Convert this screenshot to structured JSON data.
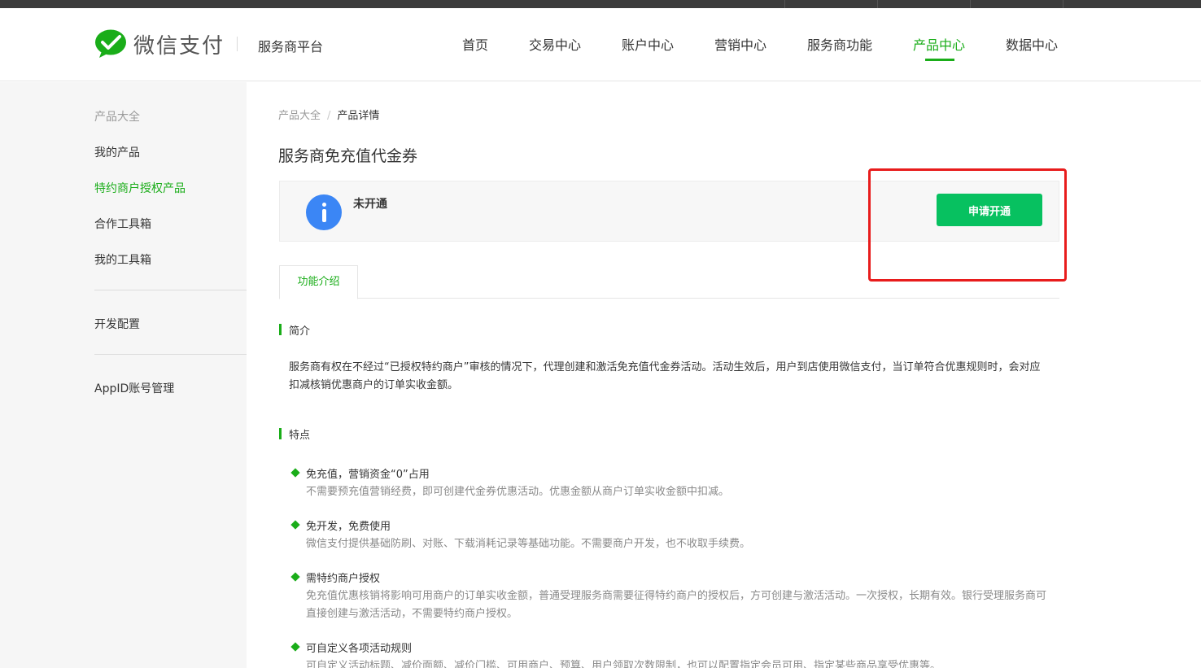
{
  "header": {
    "brand": "微信支付",
    "platform": "服务商平台",
    "nav": [
      {
        "label": "首页",
        "active": false
      },
      {
        "label": "交易中心",
        "active": false
      },
      {
        "label": "账户中心",
        "active": false
      },
      {
        "label": "营销中心",
        "active": false
      },
      {
        "label": "服务商功能",
        "active": false
      },
      {
        "label": "产品中心",
        "active": true
      },
      {
        "label": "数据中心",
        "active": false
      }
    ]
  },
  "sidebar": {
    "group_title": "产品大全",
    "items": [
      "我的产品",
      "特约商户授权产品",
      "合作工具箱",
      "我的工具箱"
    ],
    "active_item": "特约商户授权产品",
    "dev_config": "开发配置",
    "appid": "AppID账号管理"
  },
  "breadcrumb": {
    "parent": "产品大全",
    "sep": "/",
    "current": "产品详情"
  },
  "product": {
    "title": "服务商免充值代金券",
    "status": "未开通",
    "apply_label": "申请开通"
  },
  "tabs": [
    {
      "label": "功能介绍",
      "active": true
    }
  ],
  "intro": {
    "heading": "简介",
    "text": "服务商有权在不经过“已授权特约商户”审核的情况下，代理创建和激活免充值代金券活动。活动生效后，用户到店使用微信支付，当订单符合优惠规则时，会对应扣减核销优惠商户的订单实收金额。"
  },
  "features": {
    "heading": "特点",
    "items": [
      {
        "title": "免充值，营销资金“0”占用",
        "desc": "不需要预充值营销经费，即可创建代金券优惠活动。优惠金额从商户订单实收金额中扣减。"
      },
      {
        "title": "免开发，免费使用",
        "desc": "微信支付提供基础防刷、对账、下载消耗记录等基础功能。不需要商户开发，也不收取手续费。"
      },
      {
        "title": "需特约商户授权",
        "desc": "免充值优惠核销将影响可用商户的订单实收金额，普通受理服务商需要征得特约商户的授权后，方可创建与激活活动。一次授权，长期有效。银行受理服务商可直接创建与激活活动，不需要特约商户授权。"
      },
      {
        "title": "可自定义各项活动规则",
        "desc": "可自定义活动标题、减价面额、减价门槛、可用商户、预算、用户领取次数限制，也可以配置指定会员可用、指定某些商品享受优惠等。"
      }
    ]
  },
  "colors": {
    "accent": "#1aad19",
    "button": "#07c160",
    "info": "#3b86f5",
    "highlight": "#e81c1c"
  }
}
